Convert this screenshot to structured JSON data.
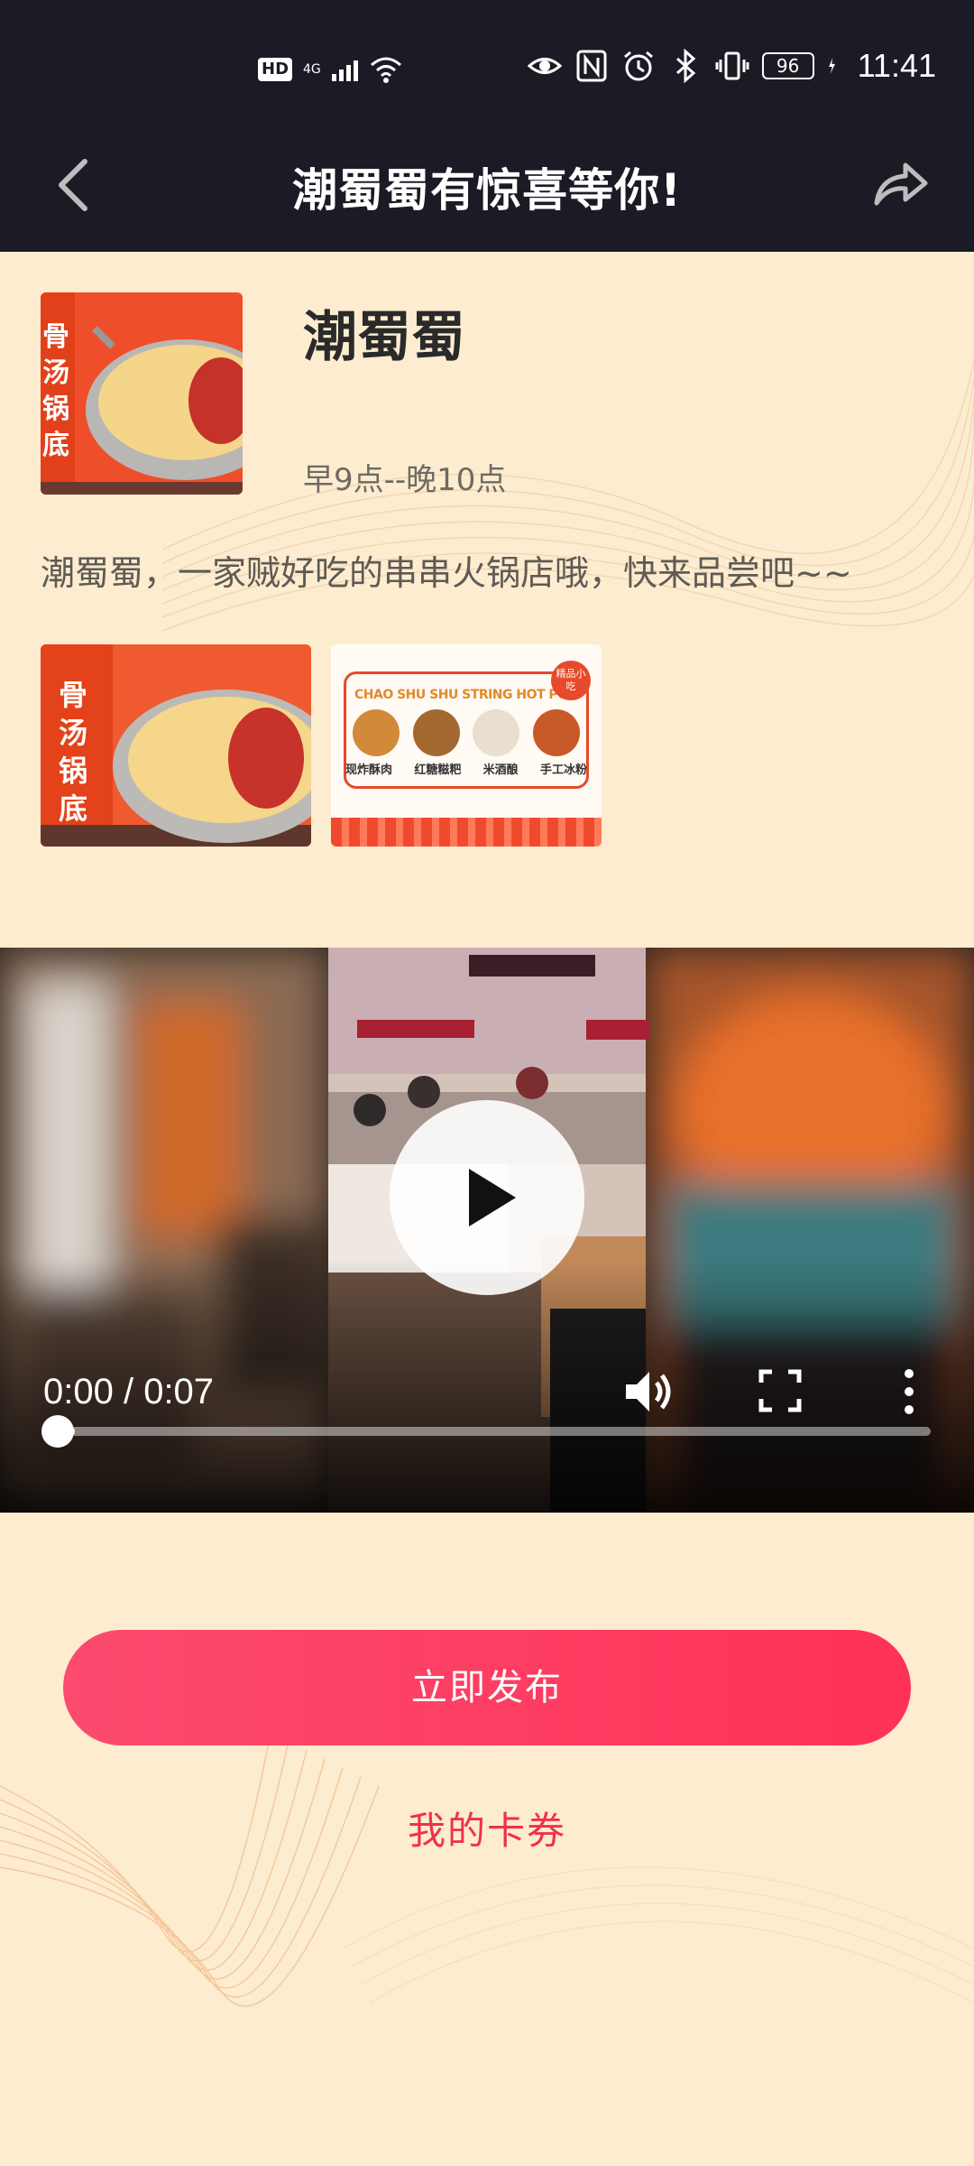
{
  "status_bar": {
    "network_badge": "HD",
    "network_type": "4G",
    "battery": "96",
    "time": "11:41"
  },
  "header": {
    "title": "潮蜀蜀有惊喜等你!"
  },
  "store": {
    "name": "潮蜀蜀",
    "hours": "早9点--晚10点",
    "description": "潮蜀蜀，一家贼好吃的串串火锅店哦，快来品尝吧~~",
    "thumb_banner_text": "骨汤锅底",
    "gallery": [
      {
        "type": "hotpot",
        "banner_text": "骨汤锅底"
      },
      {
        "type": "menu",
        "headline": "CHAO SHU SHU STRING HOT POT",
        "corner_tag": "精品小吃",
        "items": [
          "现炸酥肉",
          "红糖糍粑",
          "米酒酿",
          "手工冰粉"
        ]
      }
    ]
  },
  "video": {
    "time_display": "0:00 / 0:07",
    "progress": 0.02,
    "icons": [
      "play-icon",
      "volume-icon",
      "fullscreen-icon",
      "more-vert-icon"
    ]
  },
  "actions": {
    "publish_label": "立即发布",
    "coupons_label": "我的卡券"
  },
  "colors": {
    "header_bg": "#1a1b24",
    "page_bg": "#fdecd0",
    "accent": "#ff3157",
    "coupon_text": "#f0304f"
  }
}
